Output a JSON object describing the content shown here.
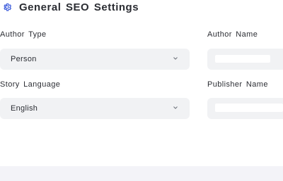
{
  "header": {
    "title": "General SEO Settings",
    "icon": "gear-icon",
    "icon_color": "#3b5bdb"
  },
  "fields": {
    "author_type": {
      "label": "Author Type",
      "value": "Person"
    },
    "author_name": {
      "label": "Author Name",
      "value": ""
    },
    "story_language": {
      "label": "Story Language",
      "value": "English"
    },
    "publisher_name": {
      "label": "Publisher Name",
      "value": ""
    }
  },
  "colors": {
    "field_background": "#f1f2f4",
    "footer_background": "#f3f3f8",
    "text": "#2b2d33"
  }
}
